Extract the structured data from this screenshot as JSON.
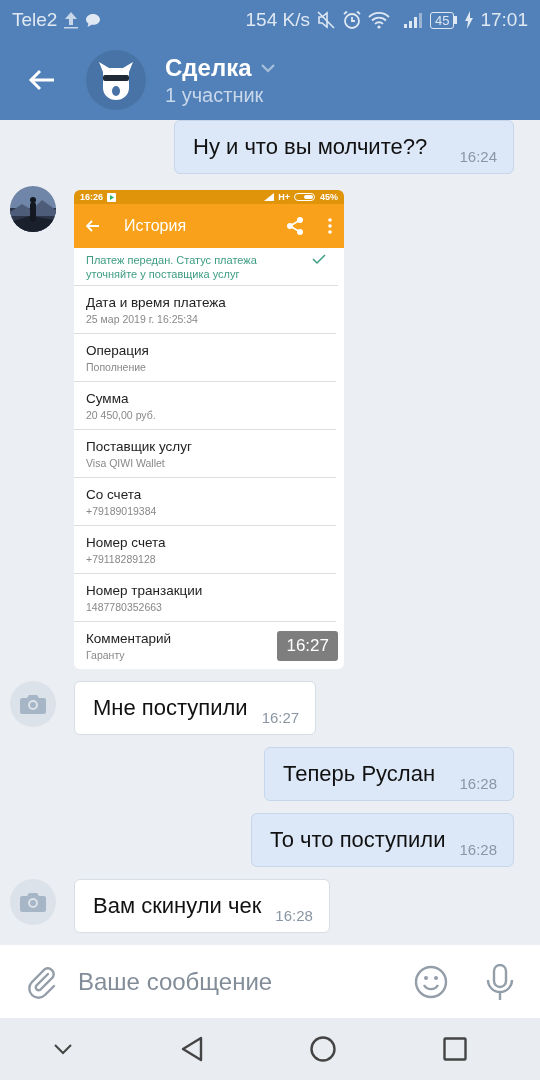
{
  "status_bar": {
    "carrier": "Tele2",
    "speed": "154 K/s",
    "battery": "45",
    "time": "17:01"
  },
  "header": {
    "title": "Сделка",
    "subtitle": "1 участник"
  },
  "messages": [
    {
      "kind": "text",
      "outgoing": true,
      "text": "Ну и что вы молчите??",
      "time": "16:24"
    },
    {
      "outgoing": false,
      "time": "16:27",
      "screenshot": {
        "status_time": "16:26",
        "network": "H+",
        "battery": "45%",
        "title": "История",
        "notice": "Платеж передан. Статус платежа уточняйте у поставщика услуг",
        "fields": [
          {
            "label": "Дата и время платежа",
            "value": "25 мар 2019 г. 16:25:34"
          },
          {
            "label": "Операция",
            "value": "Пополнение"
          },
          {
            "label": "Сумма",
            "value": "20 450,00 руб."
          },
          {
            "label": "Поставщик услуг",
            "value": "Visa QIWI Wallet"
          },
          {
            "label": "Со счета",
            "value": "+79189019384"
          },
          {
            "label": "Номер счета",
            "value": "+79118289128"
          },
          {
            "label": "Номер транзакции",
            "value": "1487780352663"
          },
          {
            "label": "Комментарий",
            "value": "Гаранту"
          }
        ]
      }
    },
    {
      "kind": "text",
      "outgoing": false,
      "avatar": {
        "kind": "camera"
      },
      "text": "Мне поступили",
      "time": "16:27"
    },
    {
      "kind": "text",
      "outgoing": true,
      "text": "Теперь Руслан",
      "time": "16:28"
    },
    {
      "kind": "text",
      "outgoing": true,
      "text": "То что поступили",
      "time": "16:28"
    },
    {
      "kind": "text",
      "outgoing": false,
      "avatar": {
        "kind": "camera"
      },
      "text": "Вам скинули чек",
      "time": "16:28"
    }
  ],
  "composer": {
    "placeholder": "Ваше сообщение"
  }
}
